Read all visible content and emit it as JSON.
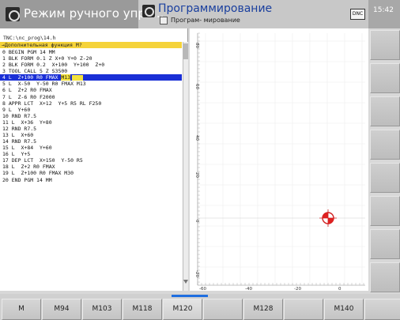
{
  "header": {
    "mode_left": "Режим ручного упра...",
    "mode_right": "Программирование",
    "mode_right_sub": "Програм- мирование",
    "dnc": "DNC",
    "clock": "15:42"
  },
  "program": {
    "path": "TNC:\\nc_prog\\14.h",
    "function_bar": "→Дополнительная функция M?",
    "lines": [
      {
        "num": "0",
        "text": "BEGIN PGM 14 MM"
      },
      {
        "num": "1",
        "text": "BLK FORM 0.1 Z X+0 Y+0 Z-20"
      },
      {
        "num": "2",
        "text": "BLK FORM 0.2  X+100  Y+100  Z+0"
      },
      {
        "num": "3",
        "text": "TOOL CALL 5 Z S3500"
      },
      {
        "num": "4",
        "text": "L  Z+100 R0 FMAX ",
        "hl": "M13"
      },
      {
        "num": "5",
        "text": "L  X-50  Y-50 R0 FMAX M13"
      },
      {
        "num": "6",
        "text": "L  Z+2 R0 FMAX"
      },
      {
        "num": "7",
        "text": "L  Z-6 R0 F2000"
      },
      {
        "num": "8",
        "text": "APPR LCT  X+12  Y+5 R5 RL F250"
      },
      {
        "num": "9",
        "text": "L  Y+60"
      },
      {
        "num": "10",
        "text": "RND R7.5"
      },
      {
        "num": "11",
        "text": "L  X+36  Y+80"
      },
      {
        "num": "12",
        "text": "RND R7.5"
      },
      {
        "num": "13",
        "text": "L  X+60"
      },
      {
        "num": "14",
        "text": "RND R7.5"
      },
      {
        "num": "15",
        "text": "L  X+84  Y+60"
      },
      {
        "num": "16",
        "text": "L  Y+5"
      },
      {
        "num": "17",
        "text": "DEP LCT  X+150  Y-50 R5"
      },
      {
        "num": "18",
        "text": "L  Z+2 R0 FMAX"
      },
      {
        "num": "19",
        "text": "L  Z+100 R0 FMAX M30"
      },
      {
        "num": "20",
        "text": "END PGM 14 MM"
      }
    ],
    "active_line": 4
  },
  "graphic": {
    "y_ticks": [
      "80",
      "60",
      "40",
      "20",
      "0",
      "-20"
    ],
    "x_ticks": [
      "-60",
      "-40",
      "-20",
      "0"
    ]
  },
  "softkeys": [
    {
      "label": "M"
    },
    {
      "label": "M94"
    },
    {
      "label": "M103"
    },
    {
      "label": "M118"
    },
    {
      "label": "M120"
    },
    {
      "label": ""
    },
    {
      "label": "M128"
    },
    {
      "label": ""
    },
    {
      "label": "M140"
    },
    {
      "label": ""
    }
  ],
  "colors": {
    "accent": "#1a2fd6",
    "highlight": "#f4e23d",
    "marker": "#e02020"
  }
}
